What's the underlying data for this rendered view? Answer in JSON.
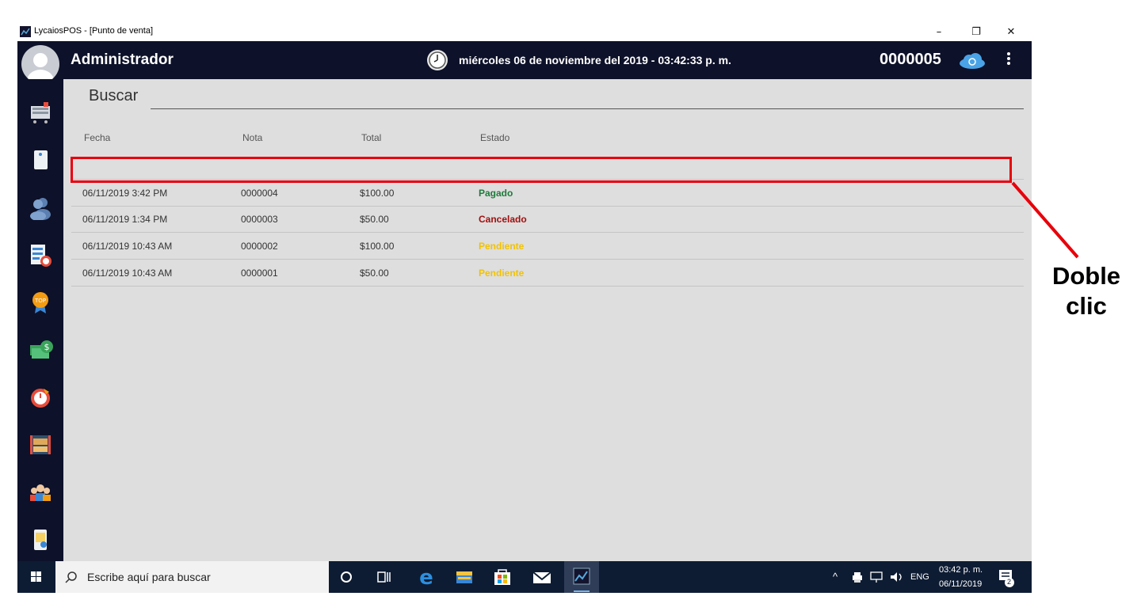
{
  "window": {
    "title": "LycaiosPOS - [Punto de venta]",
    "min_glyph": "–",
    "restore_glyph": "❐",
    "close_glyph": "✕"
  },
  "header": {
    "user": "Administrador",
    "datetime": "miércoles 06 de noviembre del 2019 - 03:42:33 p. m.",
    "sale_number": "0000005"
  },
  "sidebar": {
    "items": [
      "pos-cart-icon",
      "notes-icon",
      "customers-icon",
      "reports-clock-icon",
      "top-products-icon",
      "cash-icon",
      "alarm-icon",
      "inventory-icon",
      "users-icon",
      "mobile-doc-icon"
    ]
  },
  "search": {
    "label": "Buscar"
  },
  "table": {
    "headers": {
      "fecha": "Fecha",
      "nota": "Nota",
      "total": "Total",
      "estado": "Estado"
    },
    "rows": [
      {
        "fecha": "06/11/2019 3:42 PM",
        "nota": "0000004",
        "total": "$100.00",
        "estado": "Pagado",
        "color": "#1e7a3a"
      },
      {
        "fecha": "06/11/2019 1:34 PM",
        "nota": "0000003",
        "total": "$50.00",
        "estado": "Cancelado",
        "color": "#a30f0f"
      },
      {
        "fecha": "06/11/2019 10:43 AM",
        "nota": "0000002",
        "total": "$100.00",
        "estado": "Pendiente",
        "color": "#f2c200"
      },
      {
        "fecha": "06/11/2019 10:43 AM",
        "nota": "0000001",
        "total": "$50.00",
        "estado": "Pendiente",
        "color": "#f2c200"
      }
    ]
  },
  "annotation": {
    "line1": "Doble",
    "line2": "clic",
    "color": "#e8000b"
  },
  "taskbar": {
    "search_placeholder": "Escribe aquí para buscar",
    "lang": "ENG",
    "time": "03:42 p. m.",
    "date": "06/11/2019",
    "notifications": "2"
  }
}
